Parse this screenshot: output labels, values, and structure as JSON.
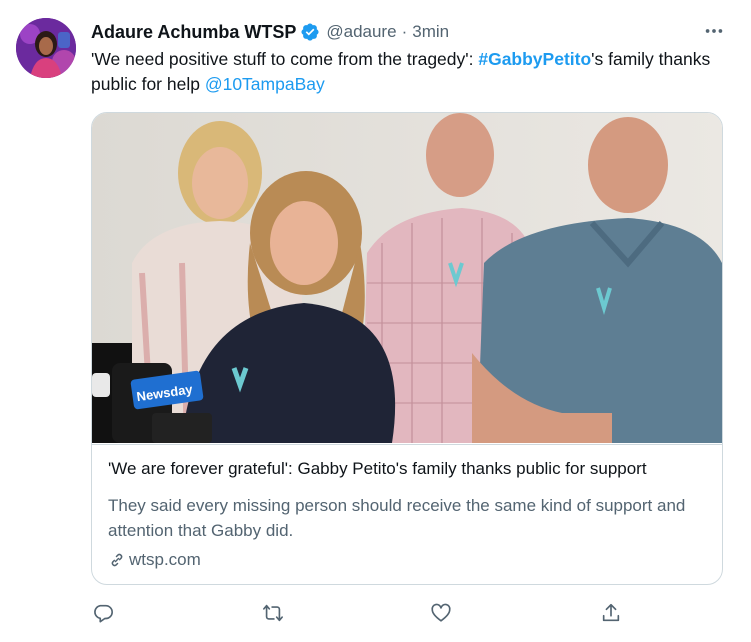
{
  "tweet": {
    "author": {
      "display_name": "Adaure Achumba WTSP",
      "verified": true,
      "handle": "@adaure",
      "separator": "·",
      "time": "3min"
    },
    "text": {
      "part1": "'We need positive stuff to come from the tragedy': ",
      "hashtag": "#GabbyPetito",
      "part2": "'s family thanks public for help ",
      "mention": "@10TampaBay"
    },
    "card": {
      "title": "'We are forever grateful': Gabby Petito's family thanks public for support",
      "description": "They said every missing person should receive the same kind of support and attention that Gabby did.",
      "domain": "wtsp.com",
      "image_mic_label": "Newsday"
    },
    "actions": [
      {
        "name": "reply",
        "icon": "reply-icon"
      },
      {
        "name": "retweet",
        "icon": "retweet-icon"
      },
      {
        "name": "like",
        "icon": "heart-icon"
      },
      {
        "name": "share",
        "icon": "share-icon"
      }
    ],
    "colors": {
      "link": "#1d9bf0",
      "secondary_text": "#536471",
      "border": "#cfd9de"
    }
  }
}
